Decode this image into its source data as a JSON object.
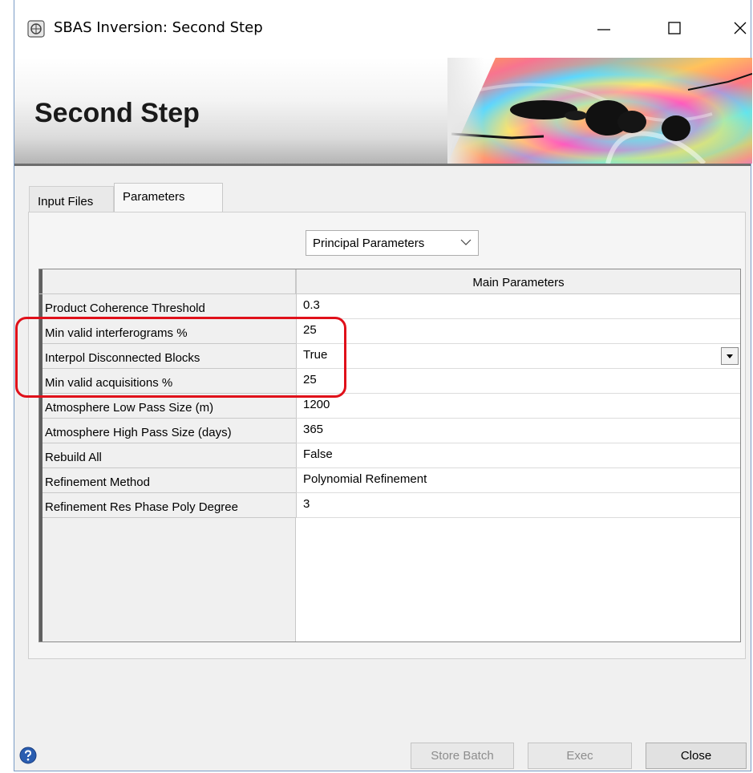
{
  "window": {
    "title": "SBAS Inversion: Second Step"
  },
  "banner": {
    "title": "Second Step"
  },
  "tabs": [
    {
      "label": "Input Files"
    },
    {
      "label": "Parameters"
    }
  ],
  "parameter_set": {
    "selected": "Principal Parameters"
  },
  "table": {
    "column_header": "Main Parameters",
    "rows": [
      {
        "label": "Product Coherence Threshold",
        "value": "0.3"
      },
      {
        "label": "Min valid interferograms %",
        "value": "25"
      },
      {
        "label": "Interpol Disconnected Blocks",
        "value": "True"
      },
      {
        "label": "Min valid acquisitions %",
        "value": "25"
      },
      {
        "label": "Atmosphere Low Pass Size (m)",
        "value": "1200"
      },
      {
        "label": "Atmosphere High Pass Size (days)",
        "value": "365"
      },
      {
        "label": "Rebuild All",
        "value": "False"
      },
      {
        "label": "Refinement Method",
        "value": "Polynomial Refinement"
      },
      {
        "label": "Refinement Res Phase Poly Degree",
        "value": "3"
      }
    ]
  },
  "buttons": {
    "store_batch": "Store Batch",
    "exec": "Exec",
    "close": "Close"
  },
  "colors": {
    "highlight": "#e0101a",
    "help_icon": "#2a5db0"
  }
}
